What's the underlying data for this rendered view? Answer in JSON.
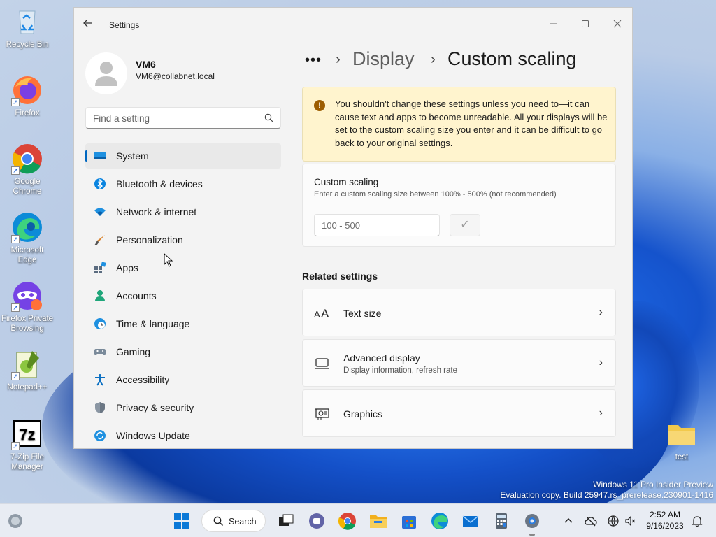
{
  "desktop": {
    "icons": [
      {
        "label": "Recycle Bin"
      },
      {
        "label": "Firefox"
      },
      {
        "label": "Google Chrome"
      },
      {
        "label": "Microsoft Edge"
      },
      {
        "label": "Firefox Private Browsing"
      },
      {
        "label": "Notepad++"
      },
      {
        "label": "7-Zip File Manager"
      },
      {
        "label": "test"
      }
    ],
    "watermark": {
      "line1": "Windows 11 Pro Insider Preview",
      "line2": "Evaluation copy. Build 25947.rs_prerelease.230901-1416"
    }
  },
  "window": {
    "title": "Settings",
    "profile": {
      "name": "VM6",
      "email": "VM6@collabnet.local"
    },
    "search": {
      "placeholder": "Find a setting"
    },
    "nav": [
      {
        "label": "System",
        "icon": "system-icon",
        "active": true
      },
      {
        "label": "Bluetooth & devices",
        "icon": "bluetooth-icon"
      },
      {
        "label": "Network & internet",
        "icon": "wifi-icon"
      },
      {
        "label": "Personalization",
        "icon": "brush-icon"
      },
      {
        "label": "Apps",
        "icon": "apps-icon"
      },
      {
        "label": "Accounts",
        "icon": "accounts-icon"
      },
      {
        "label": "Time & language",
        "icon": "globe-clock-icon"
      },
      {
        "label": "Gaming",
        "icon": "gamepad-icon"
      },
      {
        "label": "Accessibility",
        "icon": "accessibility-icon"
      },
      {
        "label": "Privacy & security",
        "icon": "shield-icon"
      },
      {
        "label": "Windows Update",
        "icon": "update-icon"
      }
    ],
    "breadcrumb": {
      "more": "•••",
      "separator": "›",
      "parent": "Display",
      "current": "Custom scaling"
    },
    "warning": {
      "icon": "!",
      "text": "You shouldn't change these settings unless you need to—it can cause text and apps to become unreadable. All your displays will be set to the custom scaling size you enter and it can be difficult to go back to your original settings."
    },
    "custom_scaling": {
      "title": "Custom scaling",
      "description": "Enter a custom scaling size between 100% - 500% (not recommended)",
      "input_placeholder": "100 - 500",
      "apply_icon": "✓"
    },
    "related": {
      "heading": "Related settings",
      "items": [
        {
          "title": "Text size",
          "subtitle": ""
        },
        {
          "title": "Advanced display",
          "subtitle": "Display information, refresh rate"
        },
        {
          "title": "Graphics",
          "subtitle": ""
        }
      ]
    }
  },
  "taskbar": {
    "search_label": "Search",
    "clock_time": "2:52 AM",
    "clock_date": "9/16/2023"
  },
  "colors": {
    "accent": "#0067c0",
    "warning_bg": "#fff4ce",
    "warning_icon": "#9d5d00"
  }
}
